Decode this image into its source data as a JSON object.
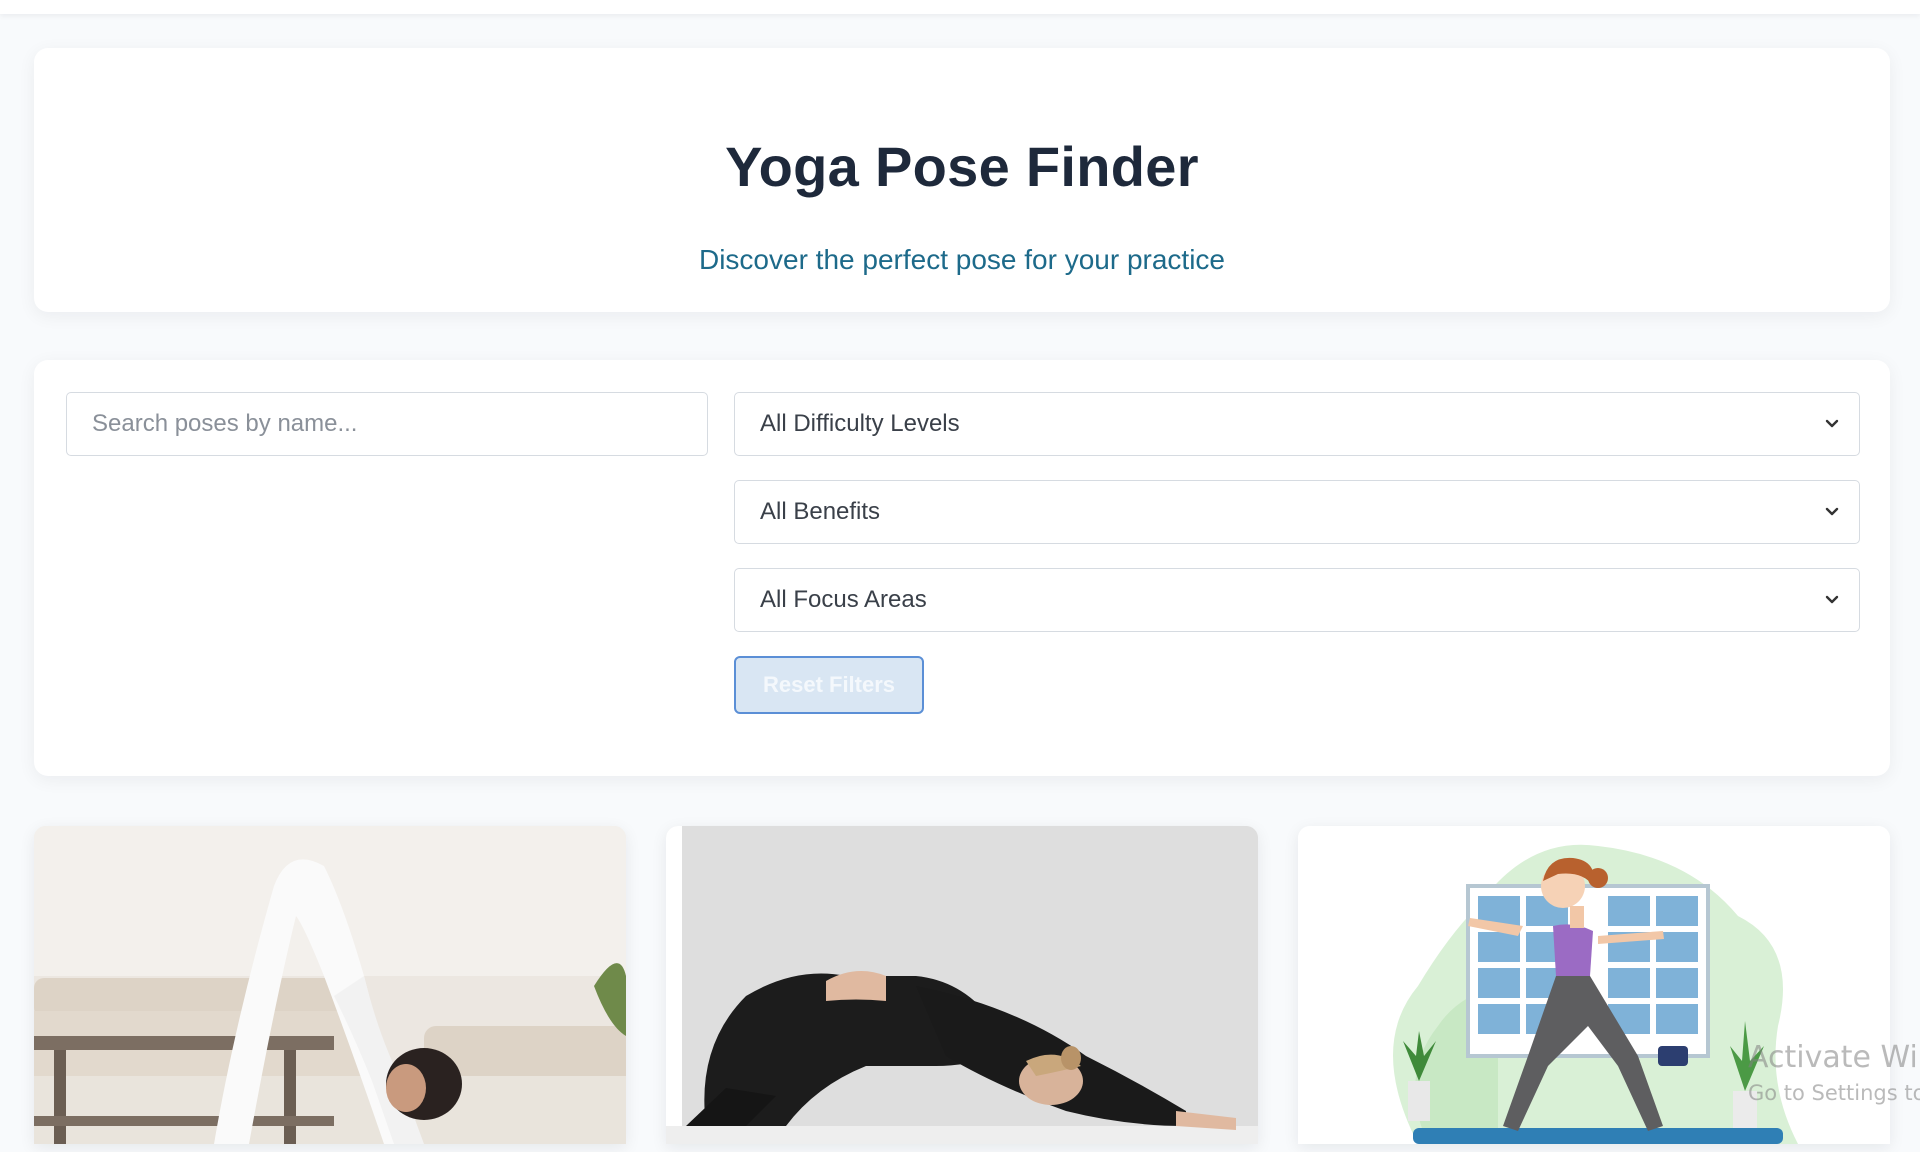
{
  "header": {
    "title": "Yoga Pose Finder",
    "subtitle": "Discover the perfect pose for your practice"
  },
  "filters": {
    "search_placeholder": "Search poses by name...",
    "difficulty_selected": "All Difficulty Levels",
    "benefits_selected": "All Benefits",
    "focus_selected": "All Focus Areas",
    "reset_label": "Reset Filters"
  },
  "cards": [
    {
      "image": "downward-dog-photo"
    },
    {
      "image": "childs-pose-photo"
    },
    {
      "image": "warrior-pose-illustration"
    }
  ],
  "watermark": {
    "line1": "Activate Windows",
    "line2": "Go to Settings to activate Windows."
  },
  "colors": {
    "title": "#1e293b",
    "subtitle": "#1d6a8a",
    "reset_border": "#5b8fd6",
    "reset_bg": "#d9e6f3"
  }
}
